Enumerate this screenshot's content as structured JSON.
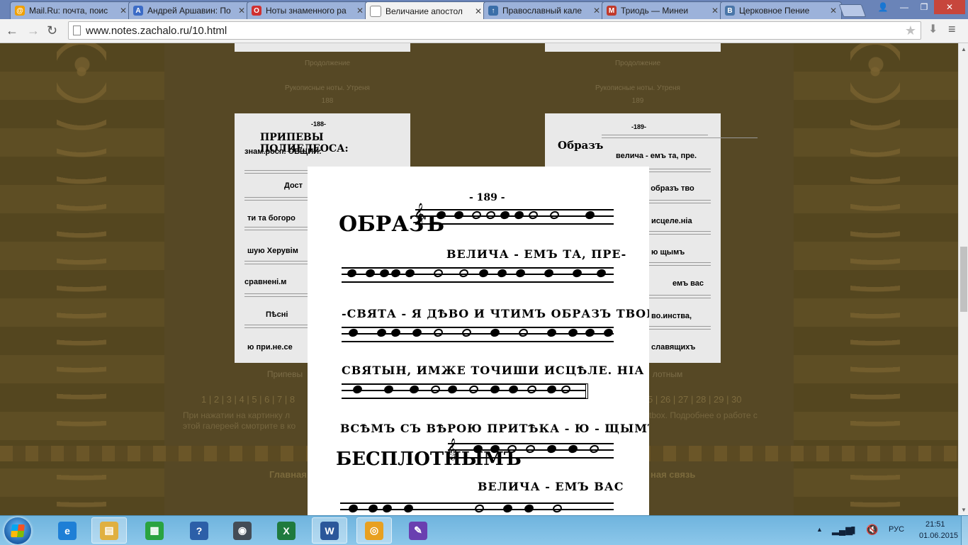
{
  "browser": {
    "tabs": [
      {
        "title": "Mail.Ru: почта, поис",
        "icon": "mailru-icon",
        "color": "#f0a000",
        "glyph": "@"
      },
      {
        "title": "Андрей Аршавин: По",
        "icon": "vk-like-icon",
        "color": "#3b6bc6",
        "glyph": "A"
      },
      {
        "title": "Ноты знаменного ра",
        "icon": "opera-icon",
        "color": "#d03030",
        "glyph": "O"
      },
      {
        "title": "Величание апостол",
        "icon": "page-icon",
        "color": "#ffffff",
        "glyph": ""
      },
      {
        "title": "Православный кале",
        "icon": "calendar-icon",
        "color": "#3a6ea8",
        "glyph": "↑"
      },
      {
        "title": "Триодь — Минеи",
        "icon": "m-icon",
        "color": "#c0392b",
        "glyph": "M"
      },
      {
        "title": "Церковное Пение",
        "icon": "vk-icon",
        "color": "#4a76a8",
        "glyph": "B"
      }
    ],
    "url": "www.notes.zachalo.ru/10.html"
  },
  "gallery": {
    "continue_label": "Продолжение",
    "caption_left": "Рукописные ноты. Утреня",
    "page_left": "188",
    "caption_right": "Рукописные ноты. Утреня",
    "page_right": "189",
    "bottom_caption_left": "Припевы",
    "bottom_caption_right": "лотным",
    "pager_left": "1 | 2 | 3 | 4 | 5 | 6 | 7 | 8",
    "pager_right": "5 | 26 | 27 | 28 | 29 | 30",
    "info_line1_left": "При нажатии на картинку л",
    "info_line1_right": "tbox. Подробнее о работе с",
    "info_line2_left": "этой галереей смотрите в ко",
    "footer_left": "Главная",
    "footer_right": "ная связь",
    "thumb_left": {
      "number": "-188-",
      "title": "ПРИПЕВЫ ПОЛИЕЛЕОСА:",
      "line2": "знам.росп. ОБЩИИ:",
      "lyrics": [
        "Дост",
        "ти та богоро",
        "шую Херувім",
        "сравнені.м",
        "Пѣсні",
        "ю при.не.се"
      ]
    },
    "thumb_right": {
      "number": "-189-",
      "lyrics": [
        "Образъ",
        "велича - емъ та, пре.",
        "мъ образъ тво",
        "исцеле.ніа",
        "ю щымъ",
        "емъ вас",
        "во.инства,",
        "славящихъ"
      ]
    }
  },
  "lightbox": {
    "page_number": "- 189 -",
    "initial1": "ОБРАЗЪ",
    "lyrics": [
      "ВЕЛИЧА - ЕМЪ ТА, ПРЕ-",
      "-СВЯТА - Я ДѢВО И ЧТИМЪ ОБРАЗЪ ТВОИ",
      "СВЯТЫН, ИМЖЕ ТОЧИШИ ИСЦѢЛЕ. НІА",
      "ВСѢМЪ СЪ ВѢРОЮ ПРИТѢКА - Ю - ЩЫМЪ."
    ],
    "initial2": "БЕСПЛОТНЫМЪ",
    "lyric_last": "ВЕЛИЧА - ЕМЪ ВАС"
  },
  "taskbar": {
    "apps": [
      {
        "name": "internet-explorer",
        "color": "#1e7fd6",
        "glyph": "e"
      },
      {
        "name": "file-explorer",
        "color": "#e0b040",
        "glyph": "▤"
      },
      {
        "name": "store",
        "color": "#2aa340",
        "glyph": "▦"
      },
      {
        "name": "help",
        "color": "#2c5fa8",
        "glyph": "?"
      },
      {
        "name": "globe",
        "color": "#444c56",
        "glyph": "◉"
      },
      {
        "name": "excel",
        "color": "#1f7a3e",
        "glyph": "X"
      },
      {
        "name": "word",
        "color": "#2b579a",
        "glyph": "W"
      },
      {
        "name": "chrome",
        "color": "#e8a020",
        "glyph": "◎"
      },
      {
        "name": "paint-app",
        "color": "#6a3fb0",
        "glyph": "✎"
      }
    ],
    "lang": "РУС",
    "time": "21:51",
    "date": "01.06.2015"
  }
}
